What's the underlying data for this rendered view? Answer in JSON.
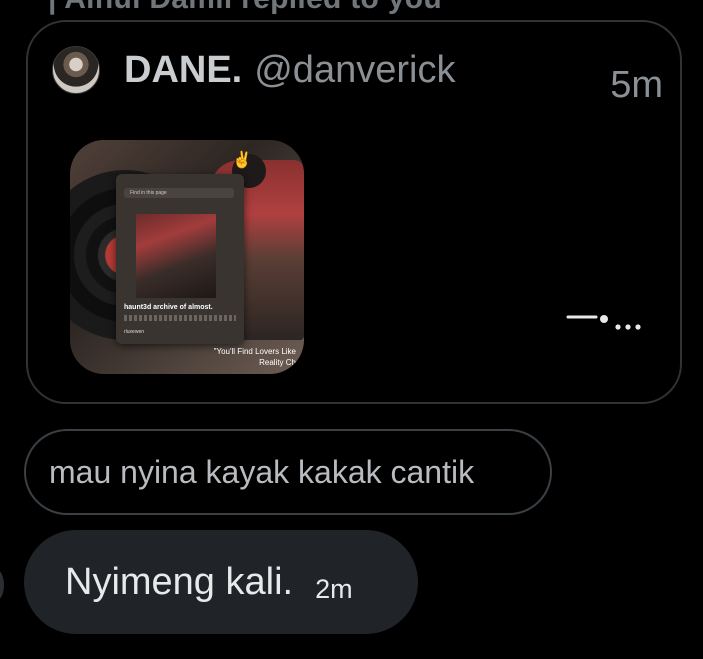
{
  "reply_banner": "| Ainul Damil replied to you",
  "quoted_post": {
    "author_name": "DANE.",
    "author_handle": "@danverick",
    "timestamp": "5m",
    "media": {
      "search_placeholder": "Find in this page",
      "title": "haunt3d archive of almost.",
      "username": "rluxewen",
      "caption_line1": "\"You'll Find Lovers Like",
      "caption_line2": "Reality Ch"
    }
  },
  "messages": [
    {
      "text": "mau nyina kayak kakak cantik"
    },
    {
      "text": "Nyimeng kali.",
      "time": "2m"
    }
  ],
  "colors": {
    "background": "#000000",
    "border": "#2f3336",
    "bubble_sent": "#202327",
    "text_primary": "#e7e9ea",
    "text_secondary": "#8b9095"
  }
}
